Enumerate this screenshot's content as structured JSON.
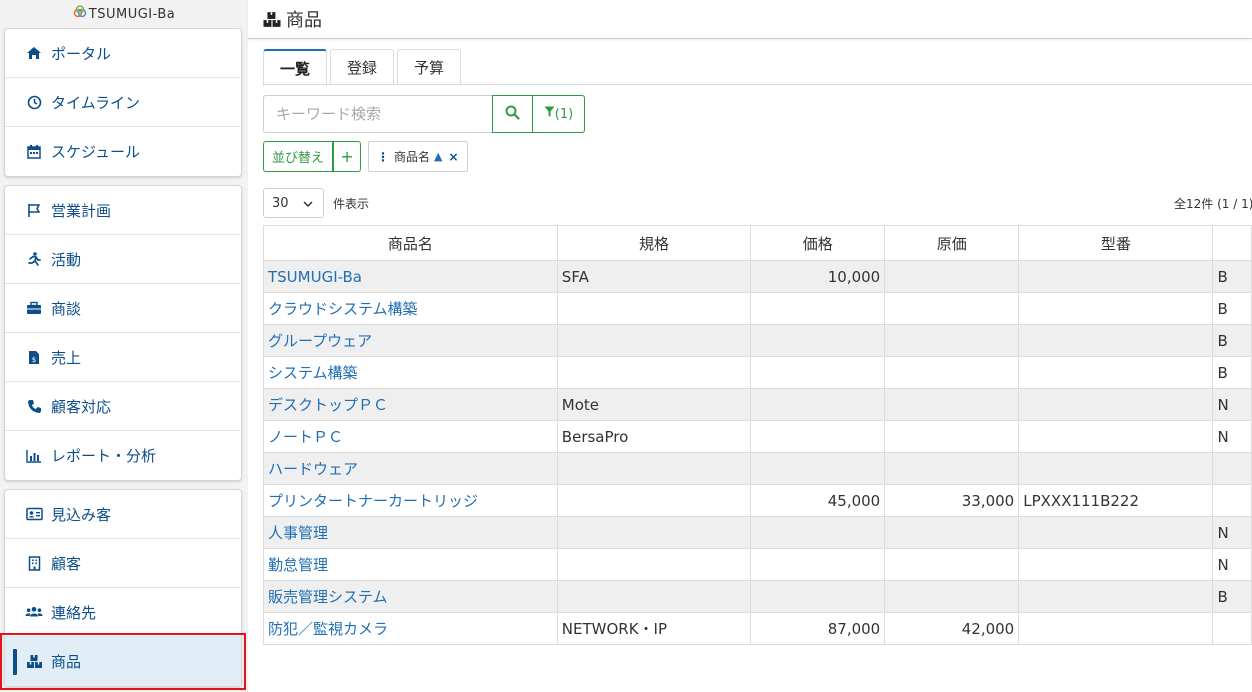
{
  "app": {
    "logo_text": "TSUMUGI-Ba"
  },
  "sidebar": {
    "group1": [
      {
        "label": "ポータル",
        "icon": "home-icon"
      },
      {
        "label": "タイムライン",
        "icon": "clock-icon"
      },
      {
        "label": "スケジュール",
        "icon": "calendar-icon"
      }
    ],
    "group2": [
      {
        "label": "営業計画",
        "icon": "flag-icon"
      },
      {
        "label": "活動",
        "icon": "running-icon"
      },
      {
        "label": "商談",
        "icon": "briefcase-icon"
      },
      {
        "label": "売上",
        "icon": "invoice-icon"
      },
      {
        "label": "顧客対応",
        "icon": "phone-icon"
      },
      {
        "label": "レポート・分析",
        "icon": "chart-icon"
      }
    ],
    "group3": [
      {
        "label": "見込み客",
        "icon": "id-card-icon"
      },
      {
        "label": "顧客",
        "icon": "building-icon"
      },
      {
        "label": "連絡先",
        "icon": "users-icon"
      },
      {
        "label": "商品",
        "icon": "boxes-icon",
        "active": true
      }
    ]
  },
  "header": {
    "title": "商品"
  },
  "tabs": [
    {
      "label": "一覧",
      "active": true
    },
    {
      "label": "登録"
    },
    {
      "label": "予算"
    }
  ],
  "search": {
    "placeholder": "キーワード検索",
    "filter_count": "(1)"
  },
  "sort": {
    "label": "並び替え",
    "add": "+",
    "chip_label": "商品名",
    "chip_direction": "▲",
    "chip_remove": "×"
  },
  "pager": {
    "per_page": "30",
    "per_page_suffix": "件表示",
    "total": "全12件 (1 / 1)"
  },
  "table": {
    "columns": [
      "商品名",
      "規格",
      "価格",
      "原価",
      "型番",
      ""
    ],
    "rows": [
      [
        "TSUMUGI-Ba",
        "SFA",
        "10,000",
        "",
        "",
        "B"
      ],
      [
        "クラウドシステム構築",
        "",
        "",
        "",
        "",
        "B"
      ],
      [
        "グループウェア",
        "",
        "",
        "",
        "",
        "B"
      ],
      [
        "システム構築",
        "",
        "",
        "",
        "",
        "B"
      ],
      [
        "デスクトップＰＣ",
        "Mote",
        "",
        "",
        "",
        "N"
      ],
      [
        "ノートＰＣ",
        "BersaPro",
        "",
        "",
        "",
        "N"
      ],
      [
        "ハードウェア",
        "",
        "",
        "",
        "",
        ""
      ],
      [
        "プリンタートナーカートリッジ",
        "",
        "45,000",
        "33,000",
        "LPXXX111B222",
        ""
      ],
      [
        "人事管理",
        "",
        "",
        "",
        "",
        "N"
      ],
      [
        "勤怠管理",
        "",
        "",
        "",
        "",
        "N"
      ],
      [
        "販売管理システム",
        "",
        "",
        "",
        "",
        "B"
      ],
      [
        "防犯／監視カメラ",
        "NETWORK・IP",
        "87,000",
        "42,000",
        "",
        ""
      ]
    ]
  },
  "colors": {
    "accent": "#0d4e8a",
    "link": "#1f6fb5",
    "green": "#2e9c45",
    "highlight": "#e0141e"
  }
}
